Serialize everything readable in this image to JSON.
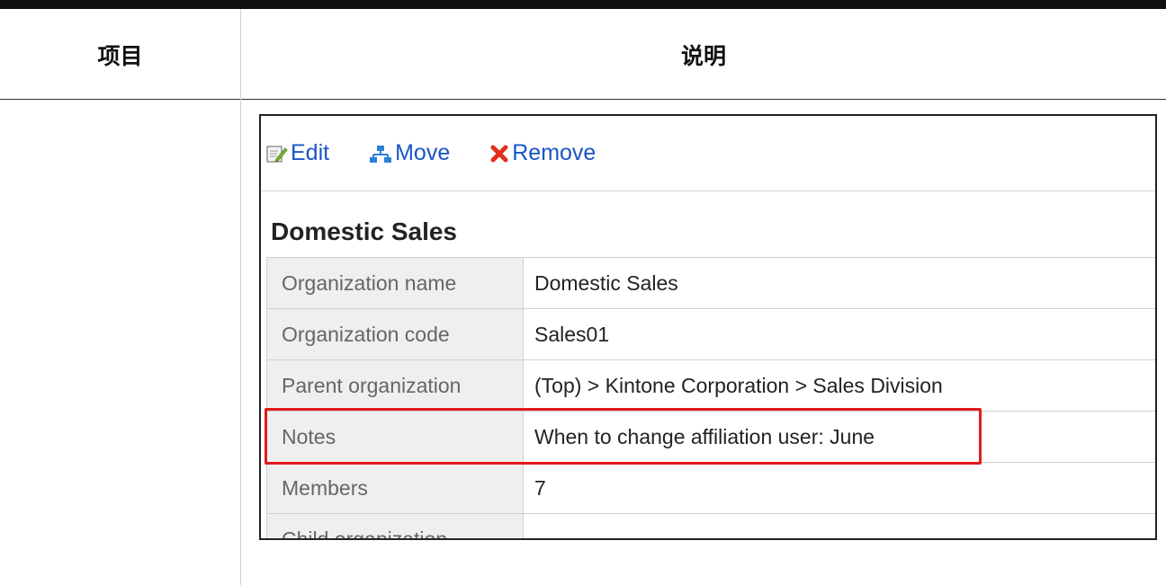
{
  "table_header": {
    "item": "项目",
    "description": "说明"
  },
  "toolbar": {
    "edit_label": "Edit",
    "move_label": "Move",
    "remove_label": "Remove"
  },
  "org": {
    "title": "Domestic Sales",
    "rows": [
      {
        "label": "Organization name",
        "value": "Domestic Sales"
      },
      {
        "label": "Organization code",
        "value": "Sales01"
      },
      {
        "label": "Parent organization",
        "value": "(Top) > Kintone Corporation > Sales Division"
      },
      {
        "label": "Notes",
        "value": "When to change affiliation user: June"
      },
      {
        "label": "Members",
        "value": "7"
      },
      {
        "label": "Child organization",
        "value": ""
      }
    ]
  },
  "colors": {
    "link": "#1a55c7",
    "highlight": "#e01b1b",
    "label_bg": "#efefef"
  },
  "icons": [
    "edit-icon",
    "move-icon",
    "remove-icon"
  ]
}
